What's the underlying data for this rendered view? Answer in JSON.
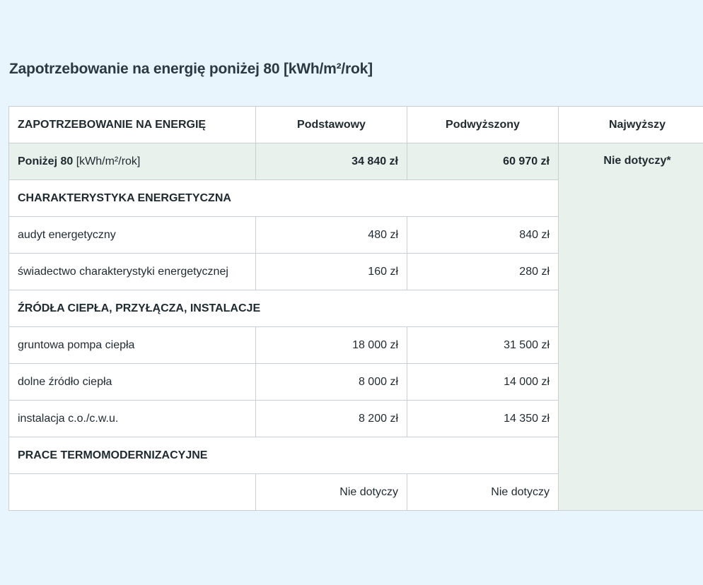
{
  "title": "Zapotrzebowanie na energię poniżej 80 [kWh/m²/rok]",
  "header": {
    "col1": "ZAPOTRZEBOWANIE NA ENERGIĘ",
    "col2": "Podstawowy",
    "col3": "Podwyższony",
    "col4": "Najwyższy"
  },
  "summary": {
    "label_bold": "Poniżej 80",
    "label_unit": " [kWh/m²/rok]",
    "basic": "34 840 zł",
    "raised": "60 970 zł",
    "highest": "Nie dotyczy*"
  },
  "sections": {
    "energy": "CHARAKTERYSTYKA ENERGETYCZNA",
    "heat": "ŹRÓDŁA CIEPŁA, PRZYŁĄCZA, INSTALACJE",
    "thermo": "PRACE TERMOMODERNIZACYJNE"
  },
  "rows": [
    {
      "label": "audyt energetyczny",
      "basic": "480 zł",
      "raised": "840 zł"
    },
    {
      "label": "świadectwo charakterystyki energetycznej",
      "basic": "160 zł",
      "raised": "280 zł"
    },
    {
      "label": "gruntowa pompa ciepła",
      "basic": "18 000 zł",
      "raised": "31 500 zł"
    },
    {
      "label": "dolne źródło ciepła",
      "basic": "8 000 zł",
      "raised": "14 000 zł"
    },
    {
      "label": "instalacja c.o./c.w.u.",
      "basic": "8 200 zł",
      "raised": "14 350 zł"
    },
    {
      "label": "",
      "basic": "Nie dotyczy",
      "raised": "Nie dotyczy"
    }
  ],
  "colors": {
    "background": "#e8f5fd",
    "highlight": "#e9f1ec",
    "border": "#c9cfd3"
  }
}
